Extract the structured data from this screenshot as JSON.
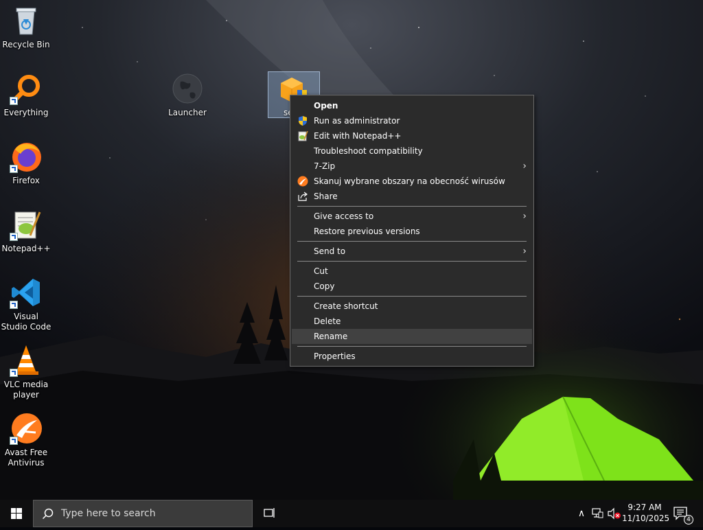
{
  "desktop": {
    "icons": [
      {
        "label": "Recycle Bin",
        "icon": "recycle-bin-icon"
      },
      {
        "label": "Everything",
        "icon": "everything-search-icon"
      },
      {
        "label": "Firefox",
        "icon": "firefox-icon"
      },
      {
        "label": "Notepad++",
        "icon": "notepad-plus-plus-icon"
      },
      {
        "label": "Visual Studio Code",
        "icon": "vscode-icon"
      },
      {
        "label": "VLC media player",
        "icon": "vlc-icon"
      },
      {
        "label": "Avast Free Antivirus",
        "icon": "avast-icon"
      },
      {
        "label": "Launcher",
        "icon": "globe-icon"
      },
      {
        "label": "se",
        "icon": "setup-installer-icon",
        "selected": true
      }
    ]
  },
  "context_menu": {
    "items": [
      {
        "label": "Open",
        "bold": true
      },
      {
        "label": "Run as administrator",
        "icon": "uac-shield-icon"
      },
      {
        "label": "Edit with Notepad++",
        "icon": "notepad-plus-plus-icon"
      },
      {
        "label": "Troubleshoot compatibility"
      },
      {
        "label": "7-Zip",
        "submenu": true
      },
      {
        "label": "Skanuj wybrane obszary na obecność wirusów",
        "icon": "avast-icon"
      },
      {
        "label": "Share",
        "icon": "share-icon"
      },
      {
        "label": "Give access to",
        "submenu": true
      },
      {
        "label": "Restore previous versions"
      },
      {
        "label": "Send to",
        "submenu": true
      },
      {
        "label": "Cut"
      },
      {
        "label": "Copy"
      },
      {
        "label": "Create shortcut"
      },
      {
        "label": "Delete"
      },
      {
        "label": "Rename",
        "hovered": true
      },
      {
        "label": "Properties"
      }
    ],
    "submenu_glyph": "›"
  },
  "taskbar": {
    "search_placeholder": "Type here to search",
    "tray_chevron": "∧",
    "time": "9:27 AM",
    "date": "11/10/2025",
    "notification_count": "4"
  },
  "colors": {
    "menu_bg": "#2b2b2b",
    "menu_hover": "#414141",
    "taskbar_bg": "#0f0f10",
    "tent_green": "#7ee21a"
  }
}
